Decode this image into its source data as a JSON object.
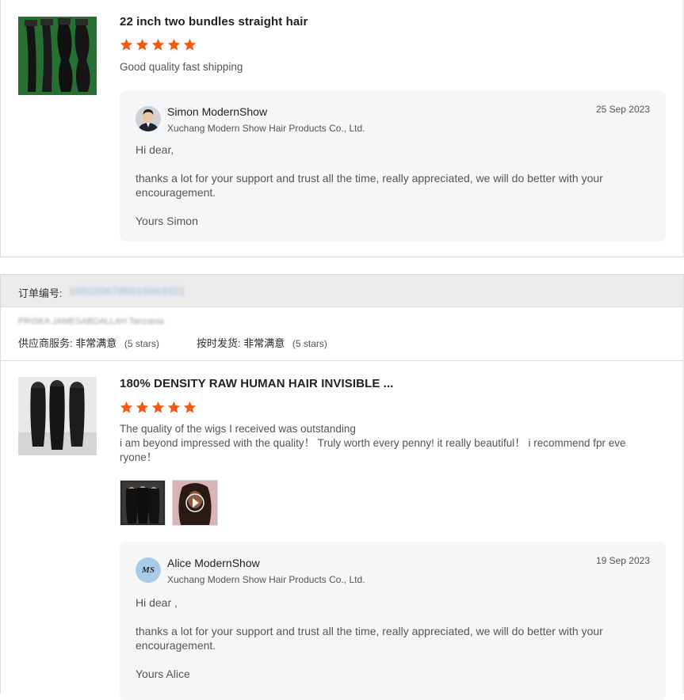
{
  "colors": {
    "star": "#f05a12",
    "reply_bg": "#f5f6f7",
    "border": "#dcdcdc"
  },
  "reviews": [
    {
      "product_title": "22 inch two bundles straight hair",
      "rating_stars": 5,
      "comment_lines": [
        "Good quality fast shipping"
      ],
      "reply": {
        "name": "Simon ModernShow",
        "company": "Xuchang Modern Show Hair Products Co., Ltd.",
        "date": "25 Sep 2023",
        "greeting": "Hi dear,",
        "body": "thanks a lot for your support and trust all the time, really appreciated, we will do better with your encouragement.",
        "signoff": "Yours Simon"
      }
    },
    {
      "product_title": "180% DENSITY RAW HUMAN HAIR INVISIBLE ...",
      "rating_stars": 5,
      "comment_lines": [
        "The quality of the wigs  I received was outstanding",
        "i am beyond impressed with the quality！  Truly worth every penny! it really beautiful！  i recommend fpr eve",
        "ryone！"
      ],
      "media": [
        "wig-photo",
        "video-thumbnail"
      ],
      "reply": {
        "name": "Alice ModernShow",
        "avatar_text": "MS",
        "company": "Xuchang Modern Show Hair Products Co., Ltd.",
        "date": "19 Sep 2023",
        "greeting": "Hi dear ,",
        "body": "thanks a lot for your support and trust all the time, really appreciated, we will do better with your encouragement.",
        "signoff": "Yours Alice"
      }
    }
  ],
  "order": {
    "label": "订单编号:",
    "number": "1652206795015063321",
    "buyer": "PRISKA JAMESABDALLAH Tanzania",
    "supplier_service_label": "供应商服务:",
    "supplier_service_value": "非常满意",
    "supplier_service_stars": "(5 stars)",
    "ontime_label": "按时发货:",
    "ontime_value": "非常满意",
    "ontime_stars": "(5 stars)"
  }
}
